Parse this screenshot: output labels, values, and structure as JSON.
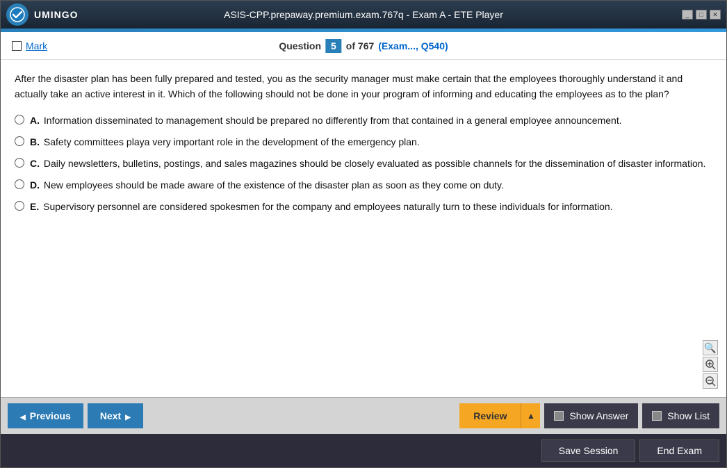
{
  "titleBar": {
    "title": "ASIS-CPP.prepaway.premium.exam.767q - Exam A - ETE Player",
    "logo": "V",
    "logoText": "UMINGO",
    "controls": [
      "_",
      "□",
      "✕"
    ]
  },
  "questionHeader": {
    "markLabel": "Mark",
    "questionLabel": "Question",
    "questionNumber": "5",
    "questionTotal": "of 767",
    "examRef": "(Exam..., Q540)"
  },
  "question": {
    "text": "After the disaster plan has been fully prepared and tested, you as the security manager must make certain that the employees thoroughly understand it and actually take an active interest in it. Which of the following should not be done in your program of informing and educating the employees as to the plan?",
    "options": [
      {
        "id": "A",
        "text": "Information disseminated to management should be prepared no differently from that contained in a general employee announcement."
      },
      {
        "id": "B",
        "text": "Safety committees playa very important role in the development of the emergency plan."
      },
      {
        "id": "C",
        "text": "Daily newsletters, bulletins, postings, and sales magazines should be closely evaluated as possible channels for the dissemination of disaster information."
      },
      {
        "id": "D",
        "text": "New employees should be made aware of the existence of the disaster plan as soon as they come on duty."
      },
      {
        "id": "E",
        "text": "Supervisory personnel are considered spokesmen for the company and employees naturally turn to these individuals for information."
      }
    ]
  },
  "zoomControls": {
    "searchLabel": "🔍",
    "zoomInLabel": "+",
    "zoomOutLabel": "−"
  },
  "footer": {
    "previousLabel": "Previous",
    "nextLabel": "Next",
    "reviewLabel": "Review",
    "showAnswerLabel": "Show Answer",
    "showListLabel": "Show List"
  },
  "actionBar": {
    "saveSessionLabel": "Save Session",
    "endExamLabel": "End Exam"
  }
}
